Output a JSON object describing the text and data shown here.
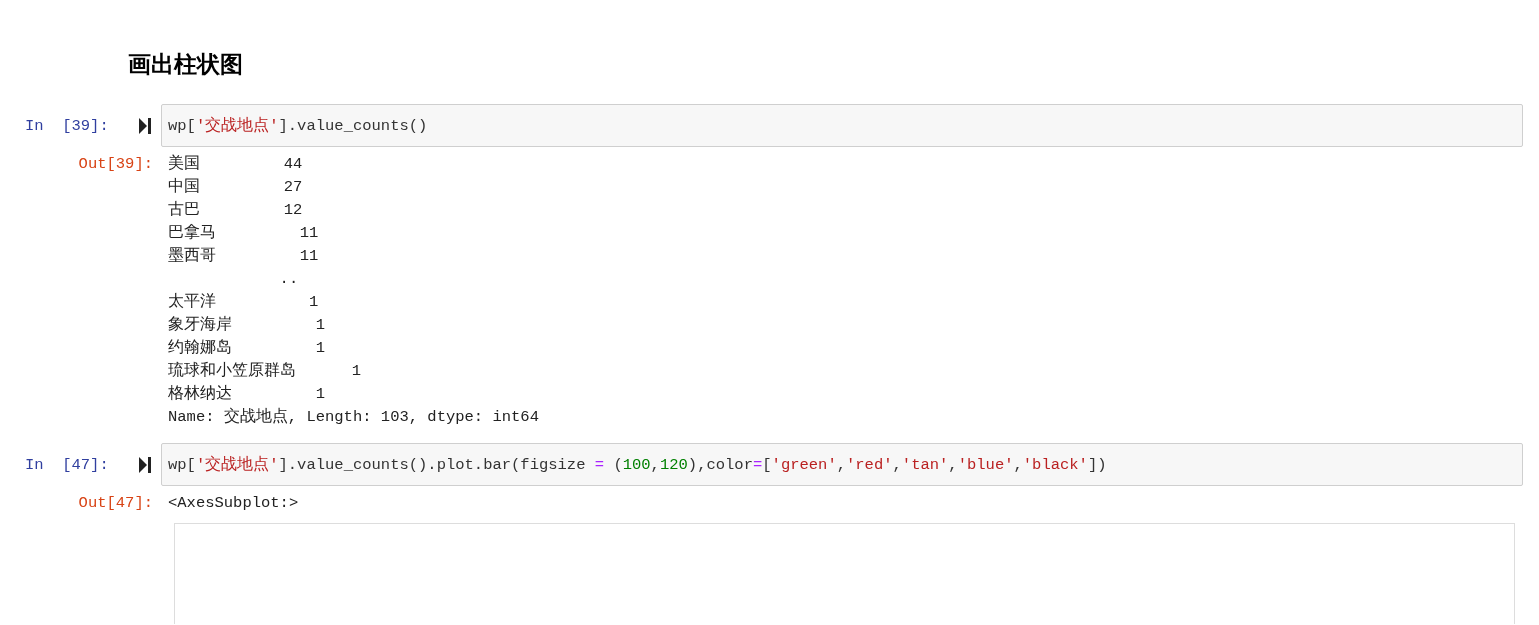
{
  "heading": "画出柱状图",
  "cells": [
    {
      "prompt": "In  [39]:",
      "code": [
        {
          "kind": "plain",
          "text": "wp["
        },
        {
          "kind": "string",
          "text": "'交战地点'"
        },
        {
          "kind": "plain",
          "text": "].value_counts()"
        }
      ],
      "out_prompt": "Out[39]:",
      "output": {
        "kind": "text",
        "lines": [
          "美国         44",
          "中国         27",
          "古巴         12",
          "巴拿马         11",
          "墨西哥         11",
          "            ..",
          "太平洋          1",
          "象牙海岸         1",
          "约翰娜岛         1",
          "琉球和小笠原群岛      1",
          "格林纳达         1",
          "Name: 交战地点, Length: 103, dtype: int64"
        ]
      }
    },
    {
      "prompt": "In  [47]:",
      "code": [
        {
          "kind": "plain",
          "text": "wp["
        },
        {
          "kind": "string",
          "text": "'交战地点'"
        },
        {
          "kind": "plain",
          "text": "].value_counts().plot.bar(figsize "
        },
        {
          "kind": "operator",
          "text": "="
        },
        {
          "kind": "plain",
          "text": " ("
        },
        {
          "kind": "number",
          "text": "100"
        },
        {
          "kind": "plain",
          "text": ","
        },
        {
          "kind": "number",
          "text": "120"
        },
        {
          "kind": "plain",
          "text": "),color"
        },
        {
          "kind": "operator",
          "text": "="
        },
        {
          "kind": "plain",
          "text": "["
        },
        {
          "kind": "string",
          "text": "'green'"
        },
        {
          "kind": "plain",
          "text": ","
        },
        {
          "kind": "string",
          "text": "'red'"
        },
        {
          "kind": "plain",
          "text": ","
        },
        {
          "kind": "string",
          "text": "'tan'"
        },
        {
          "kind": "plain",
          "text": ","
        },
        {
          "kind": "string",
          "text": "'blue'"
        },
        {
          "kind": "plain",
          "text": ","
        },
        {
          "kind": "string",
          "text": "'black'"
        },
        {
          "kind": "plain",
          "text": "])"
        }
      ],
      "out_prompt": "Out[47]:",
      "output": {
        "kind": "text",
        "lines": [
          "<AxesSubplot:>"
        ]
      }
    }
  ]
}
